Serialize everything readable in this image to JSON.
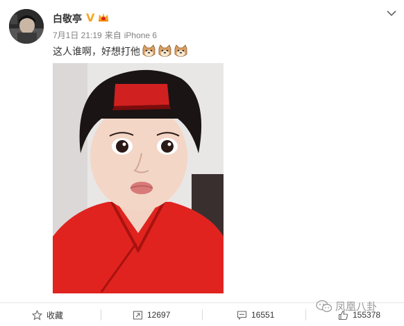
{
  "post": {
    "author_name": "白敬亭",
    "verified_mark": "V",
    "date": "7月1日 21:19",
    "source_prefix": "来自",
    "source_device": "iPhone 6",
    "text": "这人谁啊，好想打他",
    "emoji_count": 3
  },
  "icons": {
    "verified": "verified-v-icon",
    "vip": "vip-crown-icon",
    "menu": "chevron-down-icon",
    "favorite": "star-icon",
    "repost": "repost-icon",
    "comment": "comment-icon",
    "like": "thumbs-up-icon",
    "watermark": "wechat-icon"
  },
  "actions": {
    "favorite_label": "收藏",
    "repost_count": "12697",
    "comment_count": "16551",
    "like_count": "155378"
  },
  "watermark": {
    "text": "凤凰八卦"
  },
  "colors": {
    "verified": "#f5a623",
    "meta_text": "#808080",
    "shirt": "#e0231f",
    "divider": "#e6e6e6"
  }
}
